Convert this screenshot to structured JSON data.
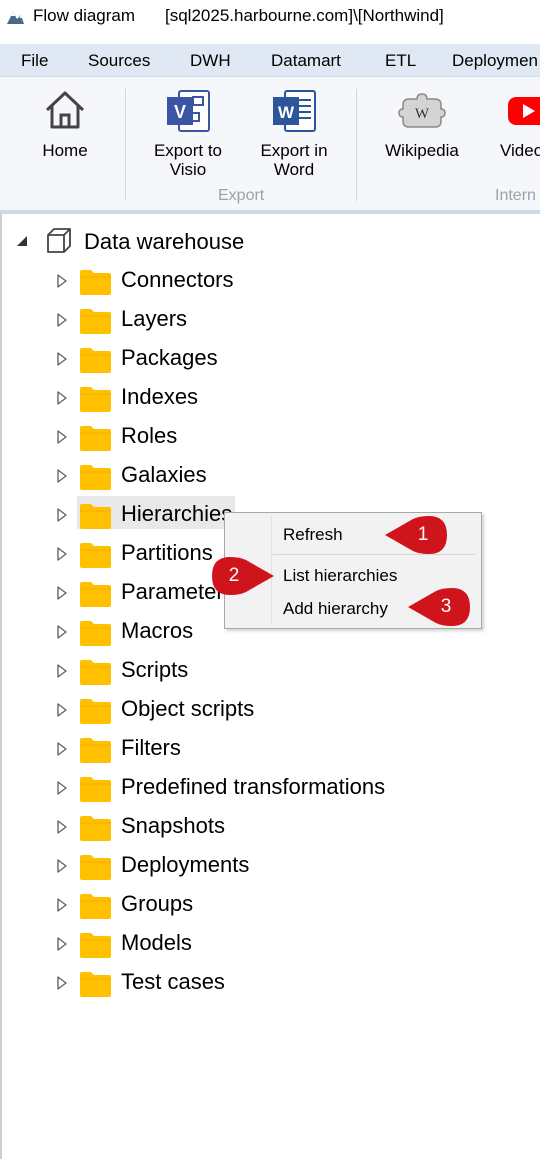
{
  "window": {
    "title": "Flow diagram",
    "connection": "[sql2025.harbourne.com]\\[Northwind]"
  },
  "menu": [
    "File",
    "Sources",
    "DWH",
    "Datamart",
    "ETL",
    "Deploymen"
  ],
  "ribbon": {
    "buttons": [
      {
        "label1": "Home",
        "label2": "",
        "icon": "home-icon"
      },
      {
        "label1": "Export to",
        "label2": "Visio",
        "icon": "visio-icon"
      },
      {
        "label1": "Export in",
        "label2": "Word",
        "icon": "word-icon"
      },
      {
        "label1": "Wikipedia",
        "label2": "",
        "icon": "wikipedia-icon"
      },
      {
        "label1": "Video",
        "label2": "",
        "icon": "youtube-icon"
      }
    ],
    "groups": [
      "Export",
      "Intern"
    ]
  },
  "tree": {
    "root": "Data warehouse",
    "items": [
      "Connectors",
      "Layers",
      "Packages",
      "Indexes",
      "Roles",
      "Galaxies",
      "Hierarchies",
      "Partitions",
      "Parameters",
      "Macros",
      "Scripts",
      "Object scripts",
      "Filters",
      "Predefined transformations",
      "Snapshots",
      "Deployments",
      "Groups",
      "Models",
      "Test cases"
    ]
  },
  "context_menu": {
    "items": [
      "Refresh",
      "List hierarchies",
      "Add hierarchy"
    ]
  },
  "callouts": [
    "1",
    "2",
    "3"
  ],
  "colors": {
    "folder": "#ffc000",
    "callout": "#d0141c",
    "menubar": "#dfe8f3",
    "visio": "#3955a3",
    "word": "#2b579a",
    "youtube": "#ff0000"
  }
}
